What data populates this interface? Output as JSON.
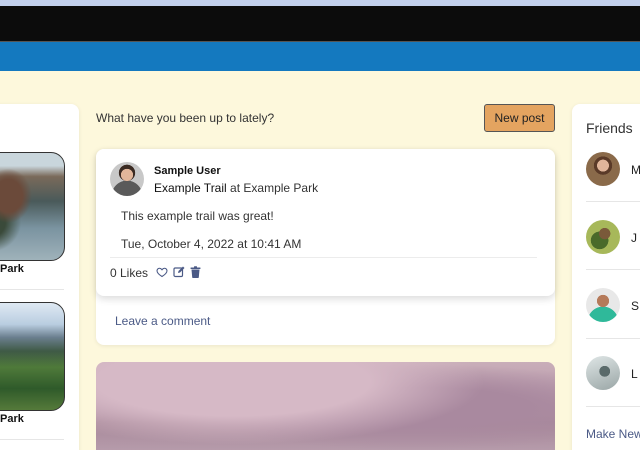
{
  "feed": {
    "prompt": "What have you been up to lately?",
    "new_post_label": "New post"
  },
  "post": {
    "author": "Sample User",
    "trail": "Example Trail",
    "at_word": "at",
    "park": "Example Park",
    "body": "This example trail was great!",
    "date": "Tue, October 4, 2022 at 10:41 AM",
    "likes": "0 Likes",
    "comment_link": "Leave a comment"
  },
  "left_panel": {
    "items": [
      {
        "label": "Park"
      },
      {
        "label": "Park"
      }
    ]
  },
  "friends": {
    "title": "Friends",
    "items": [
      {
        "initial": "M"
      },
      {
        "initial": "J"
      },
      {
        "initial": "S"
      },
      {
        "initial": "L"
      }
    ],
    "make_new": "Make New"
  },
  "colors": {
    "background": "#fdf8dc",
    "header_blue": "#1479bf",
    "button_orange": "#e4a460",
    "link": "#4b5a86"
  },
  "icons": [
    "heart-icon",
    "edit-icon",
    "trash-icon"
  ]
}
